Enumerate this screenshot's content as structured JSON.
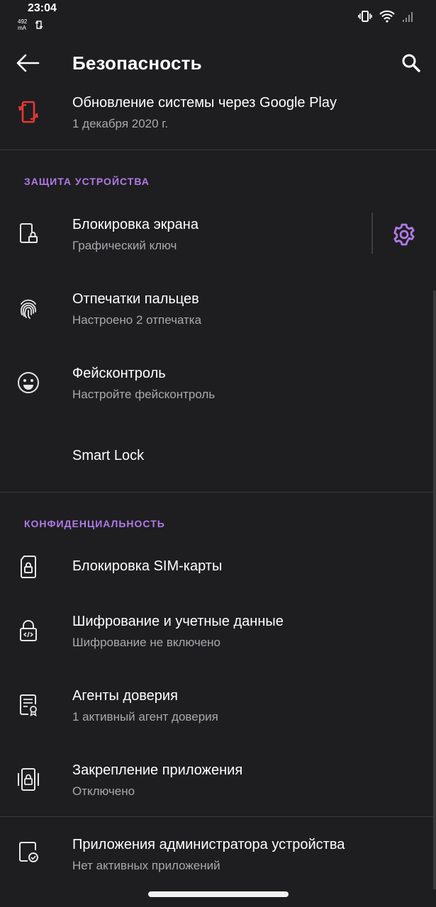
{
  "status_bar": {
    "time": "23:04",
    "current": "492\nmA",
    "icons": [
      "vibrate-icon",
      "wifi-icon",
      "signal-icon"
    ]
  },
  "app_bar": {
    "title": "Безопасность",
    "back_icon": "back-arrow-icon",
    "search_icon": "search-icon"
  },
  "top_item": {
    "title": "Обновление системы через Google Play",
    "subtitle": "1 декабря 2020 г.",
    "icon": "system-update-icon",
    "icon_color": "#e53935"
  },
  "sections": [
    {
      "header": "ЗАЩИТА УСТРОЙСТВА",
      "items": [
        {
          "title": "Блокировка экрана",
          "subtitle": "Графический ключ",
          "icon": "screen-lock-icon",
          "action_icon": "gear-icon"
        },
        {
          "title": "Отпечатки пальцев",
          "subtitle": "Настроено 2 отпечатка",
          "icon": "fingerprint-icon"
        },
        {
          "title": "Фейсконтроль",
          "subtitle": "Настройте фейсконтроль",
          "icon": "face-icon"
        },
        {
          "title": "Smart Lock",
          "subtitle": "",
          "icon": ""
        }
      ]
    },
    {
      "header": "КОНФИДЕНЦИАЛЬНОСТЬ",
      "items": [
        {
          "title": "Блокировка SIM-карты",
          "subtitle": "",
          "icon": "sim-lock-icon"
        },
        {
          "title": "Шифрование и учетные данные",
          "subtitle": "Шифрование не включено",
          "icon": "encryption-icon"
        },
        {
          "title": "Агенты доверия",
          "subtitle": "1 активный агент доверия",
          "icon": "trust-agent-icon"
        },
        {
          "title": "Закрепление приложения",
          "subtitle": "Отключено",
          "icon": "app-pin-icon"
        }
      ]
    }
  ],
  "bottom_item": {
    "title": "Приложения администратора устройства",
    "subtitle": "Нет активных приложений",
    "icon": "device-admin-icon"
  },
  "colors": {
    "background": "#1e1e20",
    "accent": "#b07ae8",
    "secondary_text": "#a9a9ad",
    "divider": "#3a3a3d"
  }
}
